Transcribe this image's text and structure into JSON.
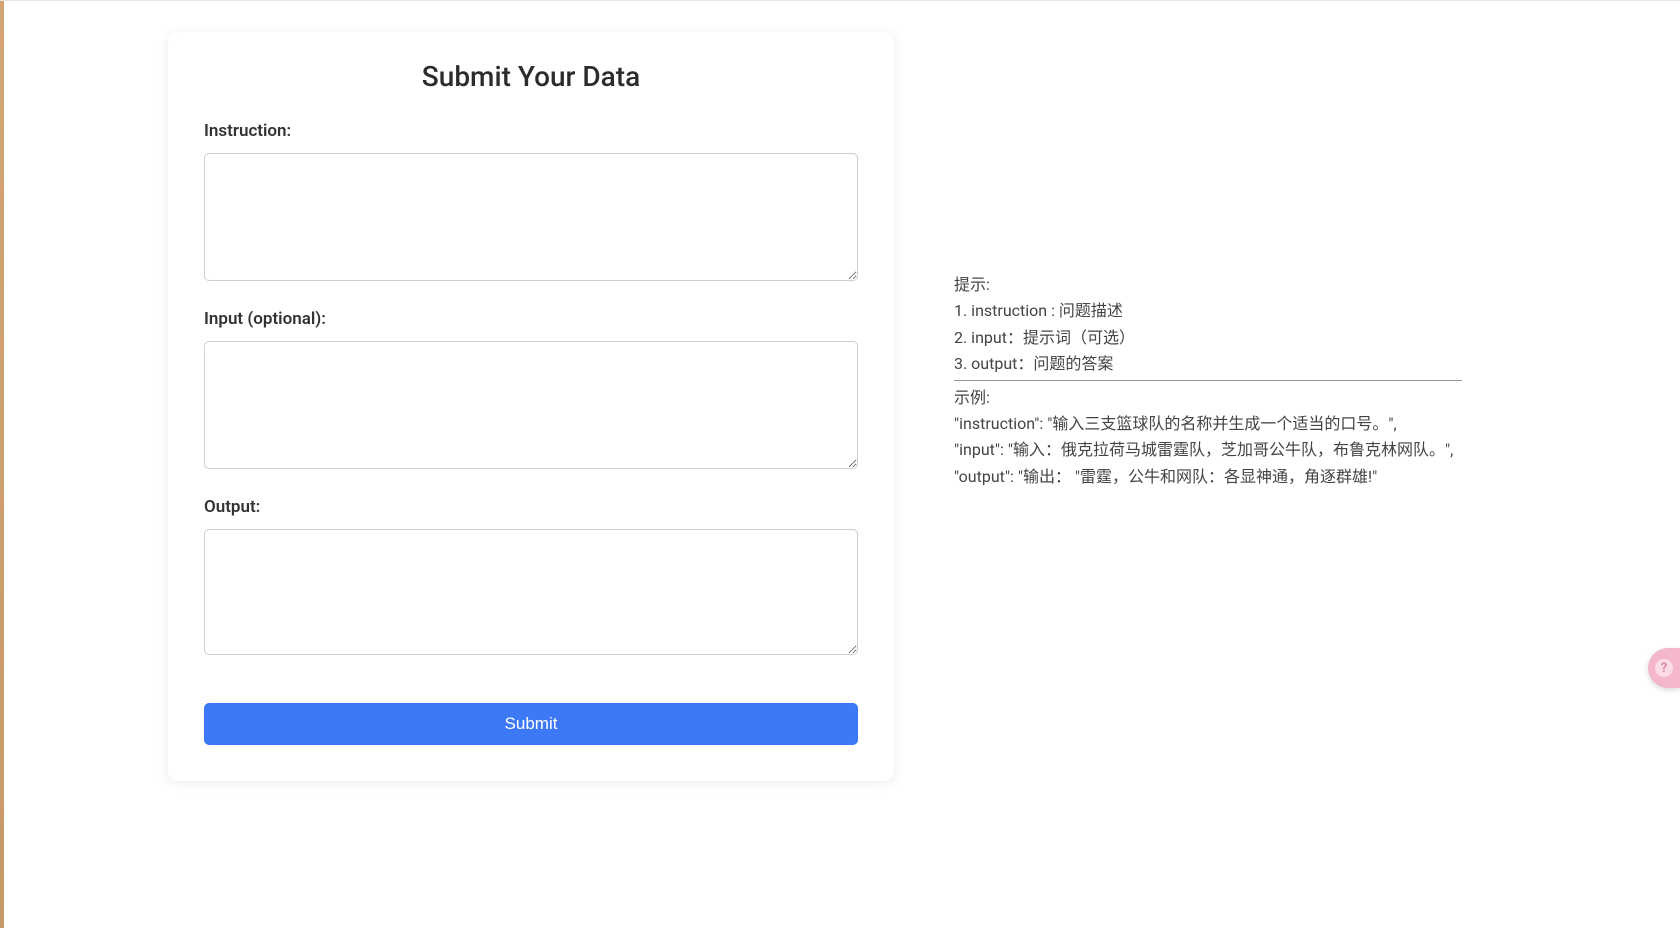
{
  "form": {
    "title": "Submit Your Data",
    "instruction_label": "Instruction:",
    "instruction_value": "",
    "input_label": "Input (optional):",
    "input_value": "",
    "output_label": "Output:",
    "output_value": "",
    "submit_label": "Submit"
  },
  "hints": {
    "heading": "提示:",
    "line1": "1. instruction : 问题描述",
    "line2": "2. input：提示词（可选）",
    "line3": "3. output：问题的答案",
    "example_heading": "示例:",
    "example_instruction": "\"instruction\": \"输入三支篮球队的名称并生成一个适当的口号。\",",
    "example_input": "\"input\": \"输入：俄克拉荷马城雷霆队，芝加哥公牛队，布鲁克林网队。\",",
    "example_output": "\"output\": \"输出： \"雷霆，公牛和网队：各显神通，角逐群雄!\""
  },
  "floating_icon": {
    "glyph": "?"
  }
}
